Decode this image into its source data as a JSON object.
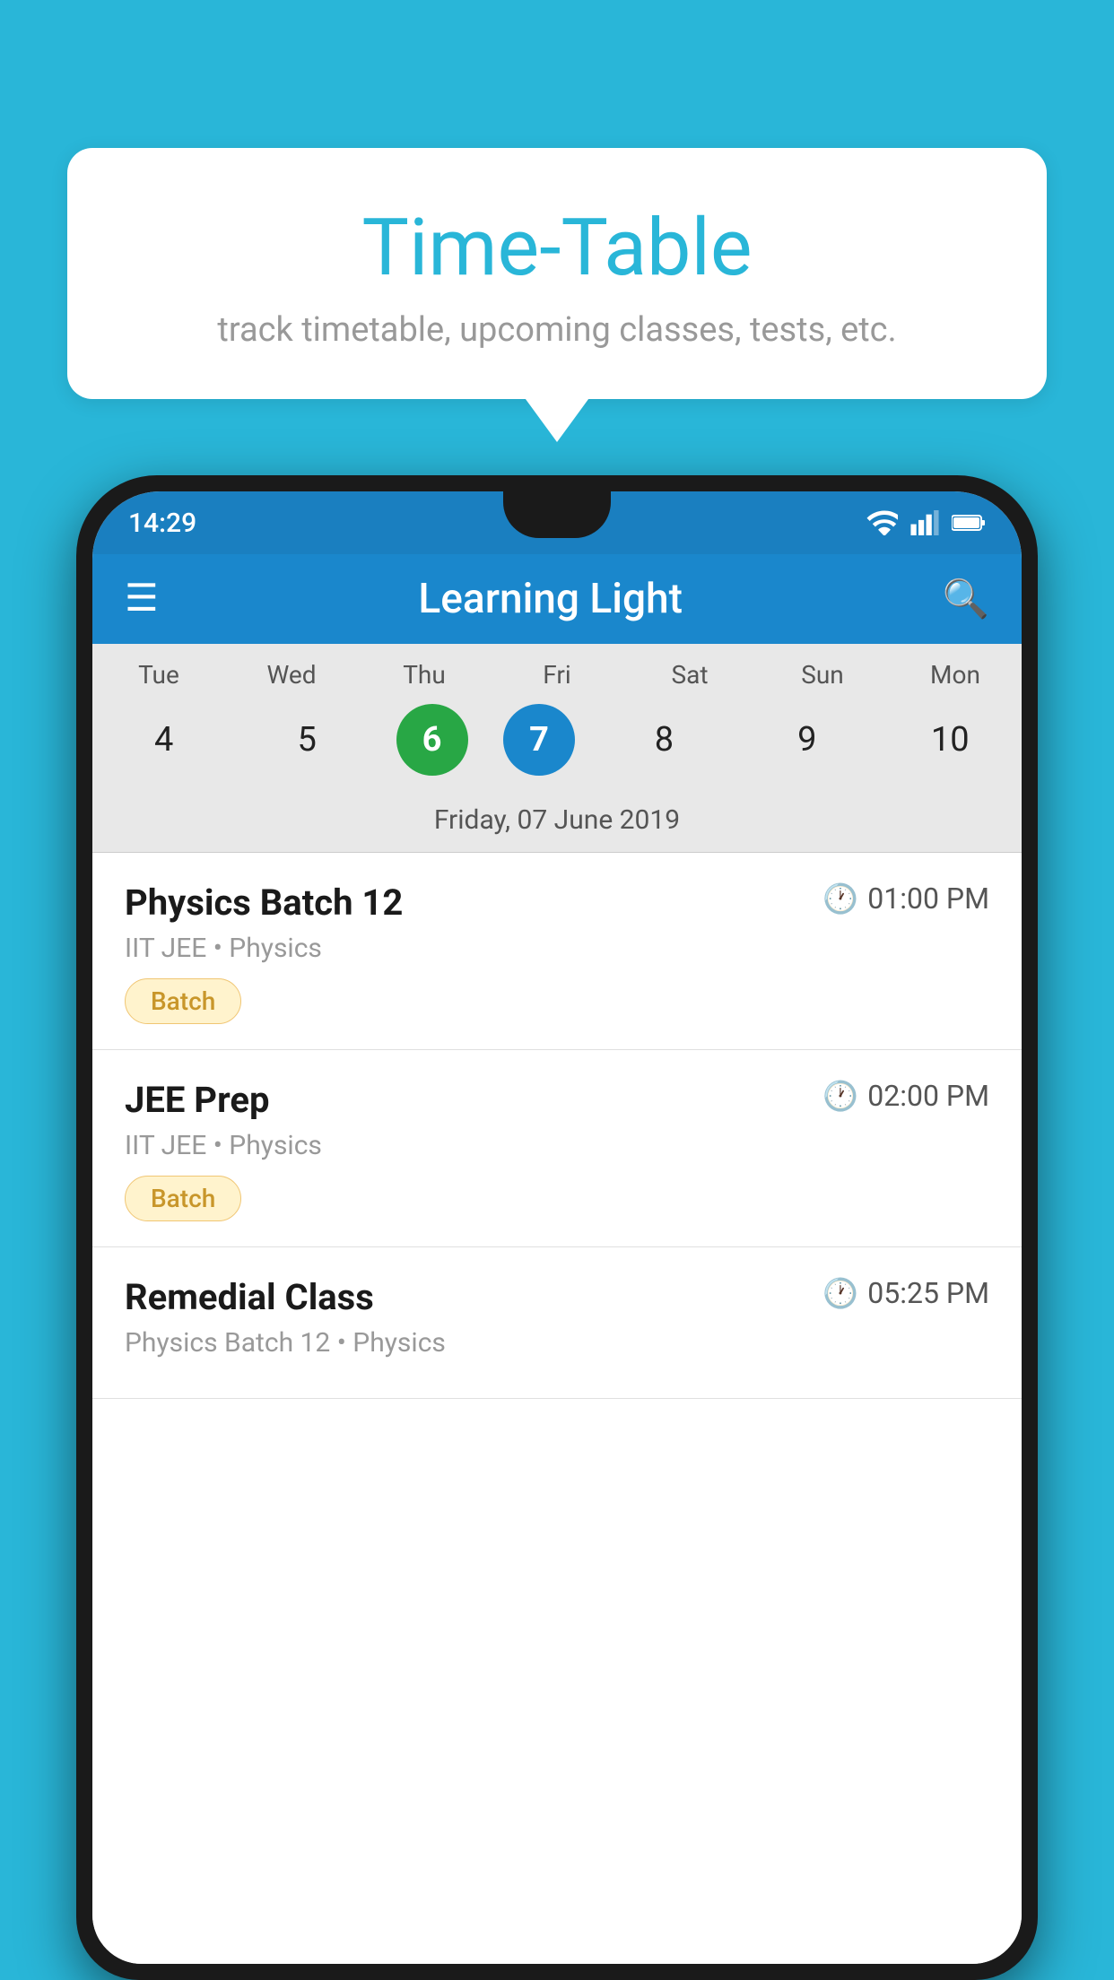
{
  "background_color": "#29b6d8",
  "bubble": {
    "title": "Time-Table",
    "subtitle": "track timetable, upcoming classes, tests, etc."
  },
  "phone": {
    "status_bar": {
      "time": "14:29",
      "icons": [
        "wifi",
        "signal",
        "battery"
      ]
    },
    "app_bar": {
      "title": "Learning Light"
    },
    "calendar": {
      "days": [
        "Tue",
        "Wed",
        "Thu",
        "Fri",
        "Sat",
        "Sun",
        "Mon"
      ],
      "dates": [
        "4",
        "5",
        "6",
        "7",
        "8",
        "9",
        "10"
      ],
      "today_index": 2,
      "selected_index": 3,
      "date_label": "Friday, 07 June 2019"
    },
    "schedule": [
      {
        "title": "Physics Batch 12",
        "time": "01:00 PM",
        "sub": "IIT JEE • Physics",
        "badge": "Batch"
      },
      {
        "title": "JEE Prep",
        "time": "02:00 PM",
        "sub": "IIT JEE • Physics",
        "badge": "Batch"
      },
      {
        "title": "Remedial Class",
        "time": "05:25 PM",
        "sub": "Physics Batch 12 • Physics",
        "badge": ""
      }
    ]
  },
  "labels": {
    "menu_icon": "≡",
    "search_icon": "🔍",
    "clock_icon": "🕐"
  }
}
